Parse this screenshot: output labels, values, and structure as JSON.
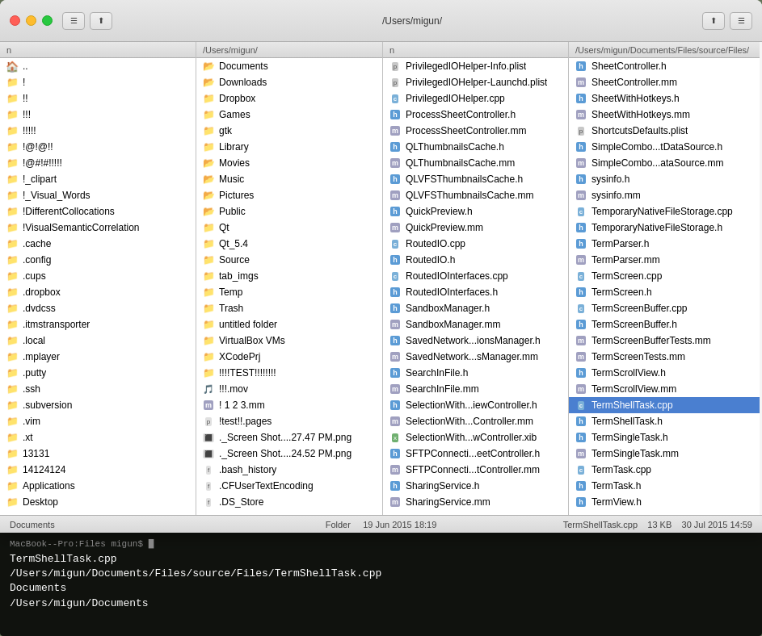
{
  "window": {
    "title": "/Users/migun/",
    "titleRight": "/Users/migun/Documents/Files/source/Files/",
    "trafficLights": [
      "close",
      "minimize",
      "maximize"
    ]
  },
  "col1": {
    "header": "n",
    "items": [
      {
        "name": "..",
        "type": "home",
        "icon": "🏠"
      },
      {
        "name": "!",
        "type": "folder"
      },
      {
        "name": "!!",
        "type": "folder"
      },
      {
        "name": "!!!",
        "type": "folder"
      },
      {
        "name": "!!!!!",
        "type": "folder"
      },
      {
        "name": "!@!@!!",
        "type": "folder"
      },
      {
        "name": "!@#!#!!!!!",
        "type": "folder"
      },
      {
        "name": "!_clipart",
        "type": "folder"
      },
      {
        "name": "!_Visual_Words",
        "type": "folder"
      },
      {
        "name": "!DifferentCollocations",
        "type": "folder"
      },
      {
        "name": "!VisualSemanticCorrelation",
        "type": "folder"
      },
      {
        "name": ".cache",
        "type": "folder"
      },
      {
        "name": ".config",
        "type": "folder"
      },
      {
        "name": ".cups",
        "type": "folder"
      },
      {
        "name": ".dropbox",
        "type": "folder"
      },
      {
        "name": ".dvdcss",
        "type": "folder"
      },
      {
        "name": ".itmstransporter",
        "type": "folder"
      },
      {
        "name": ".local",
        "type": "folder"
      },
      {
        "name": ".mplayer",
        "type": "folder"
      },
      {
        "name": ".putty",
        "type": "folder"
      },
      {
        "name": ".ssh",
        "type": "folder"
      },
      {
        "name": ".subversion",
        "type": "folder"
      },
      {
        "name": ".vim",
        "type": "folder"
      },
      {
        "name": ".xt",
        "type": "folder"
      },
      {
        "name": "13131",
        "type": "folder"
      },
      {
        "name": "14124124",
        "type": "folder"
      },
      {
        "name": "Applications",
        "type": "folder"
      },
      {
        "name": "Desktop",
        "type": "folder"
      }
    ]
  },
  "col2": {
    "header": "/Users/migun/",
    "items": [
      {
        "name": "Documents",
        "type": "folder-special"
      },
      {
        "name": "Downloads",
        "type": "folder-special"
      },
      {
        "name": "Dropbox",
        "type": "folder"
      },
      {
        "name": "Games",
        "type": "folder"
      },
      {
        "name": "gtk",
        "type": "folder"
      },
      {
        "name": "Library",
        "type": "folder"
      },
      {
        "name": "Movies",
        "type": "folder-special"
      },
      {
        "name": "Music",
        "type": "folder-special"
      },
      {
        "name": "Pictures",
        "type": "folder-special"
      },
      {
        "name": "Public",
        "type": "folder-special"
      },
      {
        "name": "Qt",
        "type": "folder"
      },
      {
        "name": "Qt_5.4",
        "type": "folder"
      },
      {
        "name": "Source",
        "type": "folder"
      },
      {
        "name": "tab_imgs",
        "type": "folder"
      },
      {
        "name": "Temp",
        "type": "folder"
      },
      {
        "name": "Trash",
        "type": "folder"
      },
      {
        "name": "untitled folder",
        "type": "folder"
      },
      {
        "name": "VirtualBox VMs",
        "type": "folder"
      },
      {
        "name": "XCodePrj",
        "type": "folder"
      },
      {
        "name": "!!!!TEST!!!!!!!!",
        "type": "folder"
      },
      {
        "name": "!!!.mov",
        "type": "file-mov"
      },
      {
        "name": "! 1 2 3.mm",
        "type": "file-mm"
      },
      {
        "name": "!test!!.pages",
        "type": "file-pages"
      },
      {
        "name": "._Screen Shot....27.47 PM.png",
        "type": "file-img"
      },
      {
        "name": "._Screen Shot....24.52 PM.png",
        "type": "file-img"
      },
      {
        "name": ".bash_history",
        "type": "file"
      },
      {
        "name": ".CFUserTextEncoding",
        "type": "file"
      },
      {
        "name": ".DS_Store",
        "type": "file"
      }
    ]
  },
  "col3": {
    "header": "n",
    "items": [
      {
        "name": "PrivilegedIOHelper-Info.plist",
        "type": "plist"
      },
      {
        "name": "PrivilegedIOHelper-Launchd.plist",
        "type": "plist"
      },
      {
        "name": "PrivilegedIOHelper.cpp",
        "type": "cpp"
      },
      {
        "name": "ProcessSheetController.h",
        "type": "h"
      },
      {
        "name": "ProcessSheetController.mm",
        "type": "mm"
      },
      {
        "name": "QLThumbnailsCache.h",
        "type": "h"
      },
      {
        "name": "QLThumbnailsCache.mm",
        "type": "mm"
      },
      {
        "name": "QLVFSThumbnailsCache.h",
        "type": "h"
      },
      {
        "name": "QLVFSThumbnailsCache.mm",
        "type": "mm"
      },
      {
        "name": "QuickPreview.h",
        "type": "h"
      },
      {
        "name": "QuickPreview.mm",
        "type": "mm"
      },
      {
        "name": "RoutedIO.cpp",
        "type": "cpp"
      },
      {
        "name": "RoutedIO.h",
        "type": "h"
      },
      {
        "name": "RoutedIOInterfaces.cpp",
        "type": "cpp"
      },
      {
        "name": "RoutedIOInterfaces.h",
        "type": "h"
      },
      {
        "name": "SandboxManager.h",
        "type": "h"
      },
      {
        "name": "SandboxManager.mm",
        "type": "mm"
      },
      {
        "name": "SavedNetwork...ionsManager.h",
        "type": "h"
      },
      {
        "name": "SavedNetwork...sManager.mm",
        "type": "mm"
      },
      {
        "name": "SearchInFile.h",
        "type": "h"
      },
      {
        "name": "SearchInFile.mm",
        "type": "mm"
      },
      {
        "name": "SelectionWith...iewController.h",
        "type": "h"
      },
      {
        "name": "SelectionWith...Controller.mm",
        "type": "mm"
      },
      {
        "name": "SelectionWith...wController.xib",
        "type": "xib"
      },
      {
        "name": "SFTPConnecti...eetController.h",
        "type": "h"
      },
      {
        "name": "SFTPConnecti...tController.mm",
        "type": "mm"
      },
      {
        "name": "SharingService.h",
        "type": "h"
      },
      {
        "name": "SharingService.mm",
        "type": "mm"
      }
    ]
  },
  "col4": {
    "header": "/Users/migun/Documents/Files/source/Files/",
    "items": [
      {
        "name": "SheetController.h",
        "type": "h"
      },
      {
        "name": "SheetController.mm",
        "type": "mm"
      },
      {
        "name": "SheetWithHotkeys.h",
        "type": "h"
      },
      {
        "name": "SheetWithHotkeys.mm",
        "type": "mm"
      },
      {
        "name": "ShortcutsDefaults.plist",
        "type": "plist"
      },
      {
        "name": "SimpleCombo...tDataSource.h",
        "type": "h"
      },
      {
        "name": "SimpleCombo...ataSource.mm",
        "type": "mm"
      },
      {
        "name": "sysinfo.h",
        "type": "h"
      },
      {
        "name": "sysinfo.mm",
        "type": "mm"
      },
      {
        "name": "TemporaryNativeFileStorage.cpp",
        "type": "cpp"
      },
      {
        "name": "TemporaryNativeFileStorage.h",
        "type": "h"
      },
      {
        "name": "TermParser.h",
        "type": "h"
      },
      {
        "name": "TermParser.mm",
        "type": "mm"
      },
      {
        "name": "TermScreen.cpp",
        "type": "cpp"
      },
      {
        "name": "TermScreen.h",
        "type": "h"
      },
      {
        "name": "TermScreenBuffer.cpp",
        "type": "cpp"
      },
      {
        "name": "TermScreenBuffer.h",
        "type": "h"
      },
      {
        "name": "TermScreenBufferTests.mm",
        "type": "mm"
      },
      {
        "name": "TermScreenTests.mm",
        "type": "mm"
      },
      {
        "name": "TermScrollView.h",
        "type": "h"
      },
      {
        "name": "TermScrollView.mm",
        "type": "mm"
      },
      {
        "name": "TermShellTask.cpp",
        "type": "cpp",
        "selected": true
      },
      {
        "name": "TermShellTask.h",
        "type": "h"
      },
      {
        "name": "TermSingleTask.h",
        "type": "h"
      },
      {
        "name": "TermSingleTask.mm",
        "type": "mm"
      },
      {
        "name": "TermTask.cpp",
        "type": "cpp"
      },
      {
        "name": "TermTask.h",
        "type": "h"
      },
      {
        "name": "TermView.h",
        "type": "h"
      }
    ]
  },
  "statusbar": {
    "left": "Documents",
    "center": "Folder",
    "date": "19 Jun 2015 18:19",
    "file": "TermShellTask.cpp",
    "size": "13 KB",
    "filedate": "30 Jul 2015 14:59"
  },
  "terminal": {
    "title": "MacBook--Pro:Files migun$",
    "lines": [
      "TermShellTask.cpp",
      "/Users/migun/Documents/Files/source/Files/TermShellTask.cpp",
      "Documents",
      "/Users/migun/Documents"
    ]
  }
}
